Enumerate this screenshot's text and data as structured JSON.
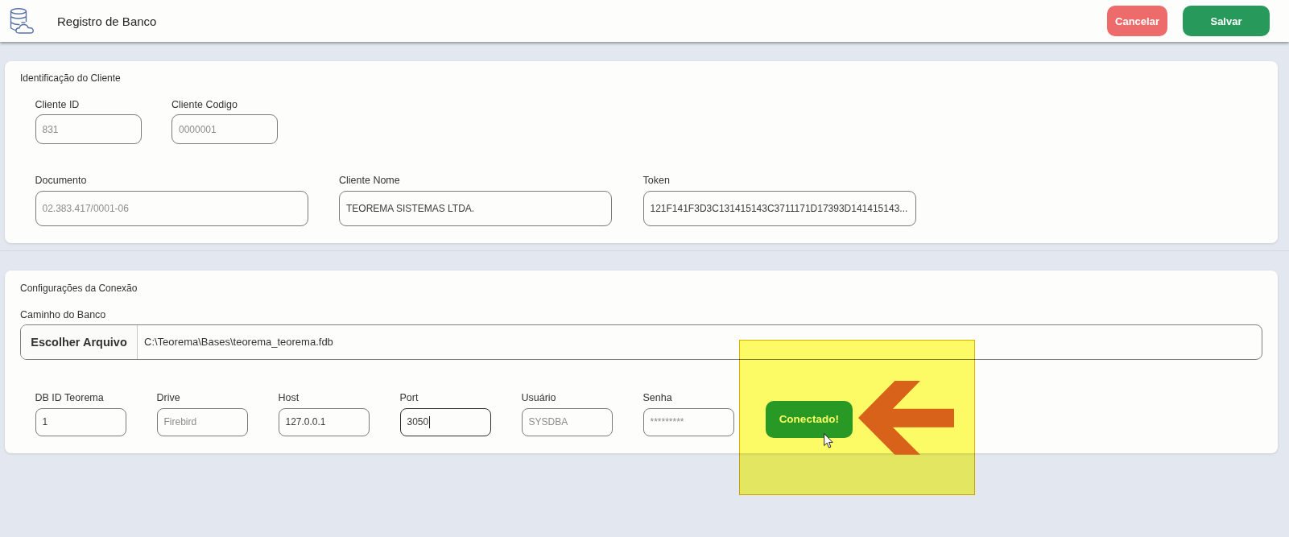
{
  "header": {
    "title": "Registro de Banco",
    "actions": [
      {
        "label": "Cancelar",
        "kind": "cancel"
      },
      {
        "label": "Salvar",
        "kind": "save"
      }
    ]
  },
  "client_section": {
    "title": "Identificação do Cliente",
    "rows": [
      {
        "kind": "short",
        "fields": [
          {
            "label": "Cliente ID",
            "value": "831",
            "disabled": true,
            "focused": false
          },
          {
            "label": "Cliente Codigo",
            "value": "0000001",
            "disabled": true,
            "focused": false
          }
        ]
      },
      {
        "kind": "long",
        "fields": [
          {
            "label": "Documento",
            "value": "02.383.417/0001-06",
            "disabled": true,
            "focused": false
          },
          {
            "label": "Cliente Nome",
            "value": "TEOREMA SISTEMAS LTDA.",
            "disabled": false,
            "focused": false
          },
          {
            "label": "Token",
            "value": "121F141F3D3C131415143C3711171D17393D141415143...",
            "disabled": false,
            "focused": false
          }
        ]
      }
    ]
  },
  "connection_section": {
    "title": "Configurações da Conexão",
    "path": {
      "label": "Caminho do Banco",
      "button": "Escolher Arquivo",
      "value": "C:\\Teorema\\Bases\\teorema_teorema.fdb"
    },
    "rows": [
      {
        "kind": "compact",
        "fields": [
          {
            "label": "DB ID Teorema",
            "value": "1",
            "disabled": false,
            "focused": false
          },
          {
            "label": "Drive",
            "value": "Firebird",
            "disabled": true,
            "focused": false
          },
          {
            "label": "Host",
            "value": "127.0.0.1",
            "disabled": false,
            "focused": false
          },
          {
            "label": "Port",
            "value": "3050",
            "disabled": false,
            "focused": true
          },
          {
            "label": "Usuário",
            "value": "SYSDBA",
            "disabled": true,
            "focused": false
          },
          {
            "label": "Senha",
            "value": "*********",
            "disabled": true,
            "focused": false
          }
        ]
      }
    ],
    "status_button": {
      "label": "Conectado!"
    }
  }
}
